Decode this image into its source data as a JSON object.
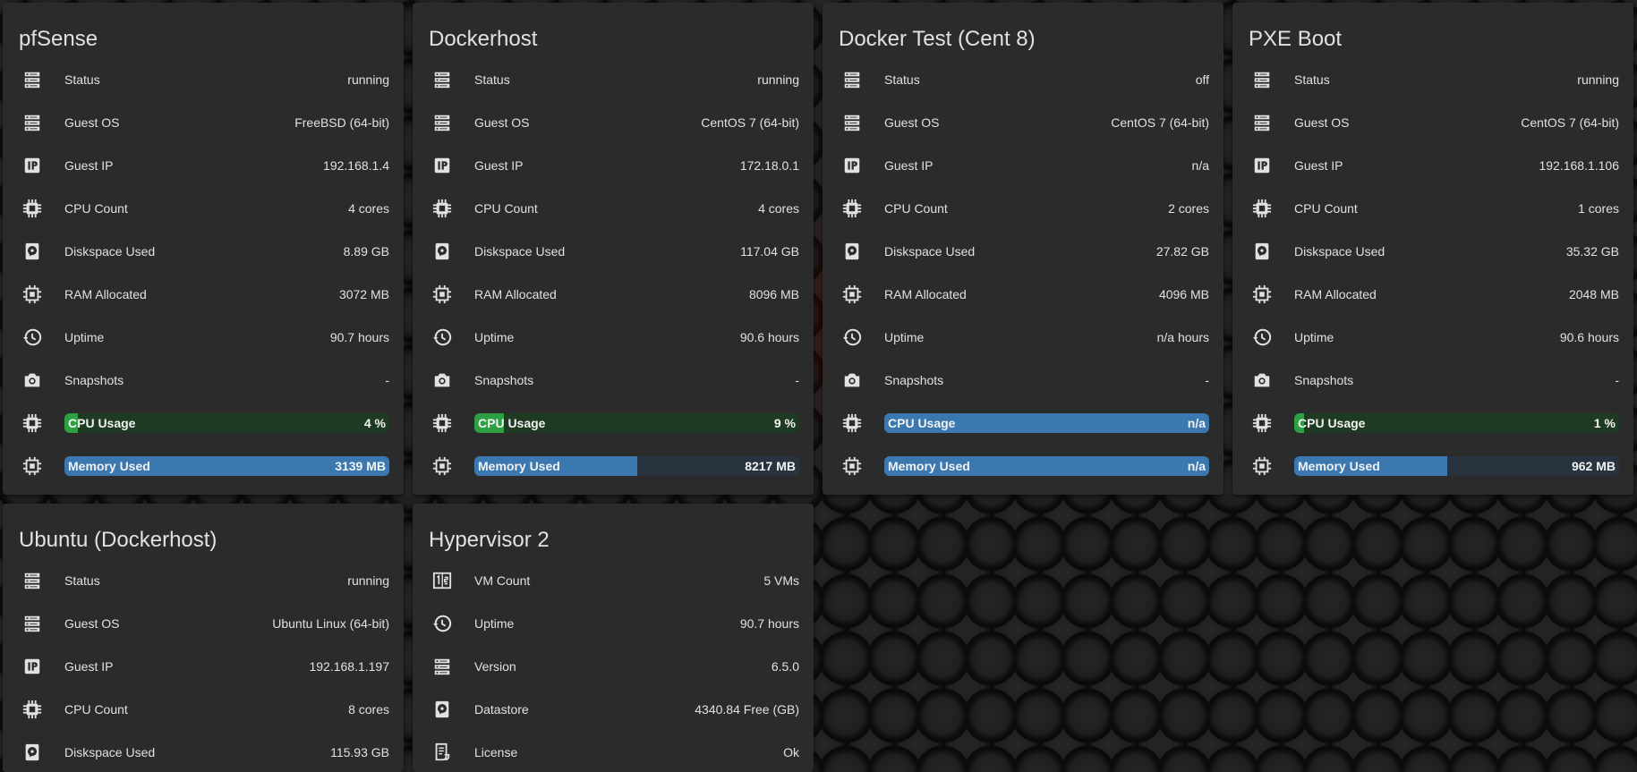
{
  "colors": {
    "card_background": "#2b2b2b",
    "text": "#e1e1e1",
    "cpu_bar": "#2ea043",
    "memory_bar": "#3b78b0"
  },
  "cards": {
    "pfsense": {
      "title": "pfSense",
      "rows": [
        {
          "label": "Status",
          "value": "running",
          "icon": "server-icon"
        },
        {
          "label": "Guest OS",
          "value": "FreeBSD (64-bit)",
          "icon": "server-icon"
        },
        {
          "label": "Guest IP",
          "value": "192.168.1.4",
          "icon": "ip-icon"
        },
        {
          "label": "CPU Count",
          "value": "4 cores",
          "icon": "cpu-icon"
        },
        {
          "label": "Diskspace Used",
          "value": "8.89 GB",
          "icon": "harddisk-icon"
        },
        {
          "label": "RAM Allocated",
          "value": "3072 MB",
          "icon": "memory-icon"
        },
        {
          "label": "Uptime",
          "value": "90.7 hours",
          "icon": "history-icon"
        },
        {
          "label": "Snapshots",
          "value": "-",
          "icon": "camera-icon"
        }
      ],
      "cpu": {
        "label": "CPU Usage",
        "value": "4 %",
        "fraction": 0.04
      },
      "memory": {
        "label": "Memory Used",
        "value": "3139 MB",
        "fraction": 1.0
      }
    },
    "dockerhost": {
      "title": "Dockerhost",
      "rows": [
        {
          "label": "Status",
          "value": "running",
          "icon": "server-icon"
        },
        {
          "label": "Guest OS",
          "value": "CentOS 7 (64-bit)",
          "icon": "server-icon"
        },
        {
          "label": "Guest IP",
          "value": "172.18.0.1",
          "icon": "ip-icon"
        },
        {
          "label": "CPU Count",
          "value": "4 cores",
          "icon": "cpu-icon"
        },
        {
          "label": "Diskspace Used",
          "value": "117.04 GB",
          "icon": "harddisk-icon"
        },
        {
          "label": "RAM Allocated",
          "value": "8096 MB",
          "icon": "memory-icon"
        },
        {
          "label": "Uptime",
          "value": "90.6 hours",
          "icon": "history-icon"
        },
        {
          "label": "Snapshots",
          "value": "-",
          "icon": "camera-icon"
        }
      ],
      "cpu": {
        "label": "CPU Usage",
        "value": "9 %",
        "fraction": 0.09
      },
      "memory": {
        "label": "Memory Used",
        "value": "8217 MB",
        "fraction": 0.5
      }
    },
    "docker_test": {
      "title": "Docker Test (Cent 8)",
      "rows": [
        {
          "label": "Status",
          "value": "off",
          "icon": "server-icon"
        },
        {
          "label": "Guest OS",
          "value": "CentOS 7 (64-bit)",
          "icon": "server-icon"
        },
        {
          "label": "Guest IP",
          "value": "n/a",
          "icon": "ip-icon"
        },
        {
          "label": "CPU Count",
          "value": "2 cores",
          "icon": "cpu-icon"
        },
        {
          "label": "Diskspace Used",
          "value": "27.82 GB",
          "icon": "harddisk-icon"
        },
        {
          "label": "RAM Allocated",
          "value": "4096 MB",
          "icon": "memory-icon"
        },
        {
          "label": "Uptime",
          "value": "n/a hours",
          "icon": "history-icon"
        },
        {
          "label": "Snapshots",
          "value": "-",
          "icon": "camera-icon"
        }
      ],
      "cpu": {
        "label": "CPU Usage",
        "value": "n/a",
        "fraction": 1.0,
        "bar_style": "blue"
      },
      "memory": {
        "label": "Memory Used",
        "value": "n/a",
        "fraction": 1.0
      }
    },
    "pxe_boot": {
      "title": "PXE Boot",
      "rows": [
        {
          "label": "Status",
          "value": "running",
          "icon": "server-icon"
        },
        {
          "label": "Guest OS",
          "value": "CentOS 7 (64-bit)",
          "icon": "server-icon"
        },
        {
          "label": "Guest IP",
          "value": "192.168.1.106",
          "icon": "ip-icon"
        },
        {
          "label": "CPU Count",
          "value": "1 cores",
          "icon": "cpu-icon"
        },
        {
          "label": "Diskspace Used",
          "value": "35.32 GB",
          "icon": "harddisk-icon"
        },
        {
          "label": "RAM Allocated",
          "value": "2048 MB",
          "icon": "memory-icon"
        },
        {
          "label": "Uptime",
          "value": "90.6 hours",
          "icon": "history-icon"
        },
        {
          "label": "Snapshots",
          "value": "-",
          "icon": "camera-icon"
        }
      ],
      "cpu": {
        "label": "CPU Usage",
        "value": "1 %",
        "fraction": 0.01
      },
      "memory": {
        "label": "Memory Used",
        "value": "962 MB",
        "fraction": 0.47
      }
    },
    "ubuntu": {
      "title": "Ubuntu (Dockerhost)",
      "rows": [
        {
          "label": "Status",
          "value": "running",
          "icon": "server-icon"
        },
        {
          "label": "Guest OS",
          "value": "Ubuntu Linux (64-bit)",
          "icon": "server-icon"
        },
        {
          "label": "Guest IP",
          "value": "192.168.1.197",
          "icon": "ip-icon"
        },
        {
          "label": "CPU Count",
          "value": "8 cores",
          "icon": "cpu-icon"
        },
        {
          "label": "Diskspace Used",
          "value": "115.93 GB",
          "icon": "harddisk-icon"
        }
      ]
    },
    "hypervisor": {
      "title": "Hypervisor 2",
      "rows": [
        {
          "label": "VM Count",
          "value": "5 VMs",
          "icon": "counter-icon"
        },
        {
          "label": "Uptime",
          "value": "90.7 hours",
          "icon": "history-icon"
        },
        {
          "label": "Version",
          "value": "6.5.0",
          "icon": "server-icon"
        },
        {
          "label": "Datastore",
          "value": "4340.84 Free (GB)",
          "icon": "harddisk-icon"
        },
        {
          "label": "License",
          "value": "Ok",
          "icon": "license-icon"
        }
      ]
    }
  }
}
